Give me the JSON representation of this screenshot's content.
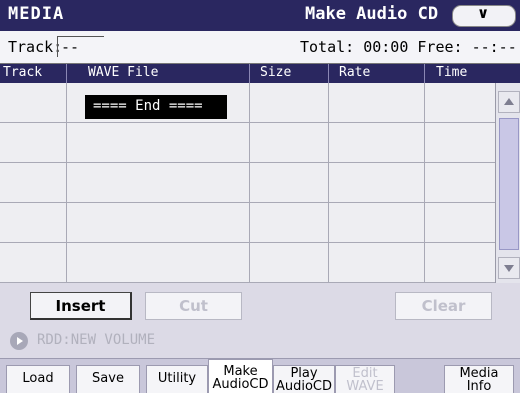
{
  "header": {
    "mode": "MEDIA",
    "page": "Make Audio CD",
    "menu_icon": "chevron-down-icon"
  },
  "info": {
    "track_label": "Track:",
    "track_value": "--",
    "stats": "Total: 00:00 Free: --:--"
  },
  "table": {
    "columns": [
      "Track",
      "WAVE File",
      "Size",
      "Rate",
      "Time"
    ],
    "end_marker": "==== End ====",
    "empty_rows": 5
  },
  "buttons": {
    "insert": "Insert",
    "cut": "Cut",
    "clear": "Clear"
  },
  "path": {
    "icon": "play-arrow-icon",
    "text": "RDD:NEW VOLUME"
  },
  "tabs": [
    {
      "line1": "Load",
      "line2": ""
    },
    {
      "line1": "Save",
      "line2": ""
    },
    {
      "line1": "Utility",
      "line2": ""
    },
    {
      "line1": "Make",
      "line2": "AudioCD"
    },
    {
      "line1": "Play",
      "line2": "AudioCD"
    },
    {
      "line1": "Edit",
      "line2": "WAVE"
    },
    {
      "line1": "Media",
      "line2": "Info"
    }
  ],
  "colors": {
    "title_bar": "#2a2760",
    "selected_tab": "#ffffff",
    "scroll_thumb": "#c9c7e6"
  }
}
